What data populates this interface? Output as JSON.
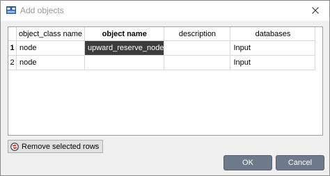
{
  "window": {
    "title": "Add objects"
  },
  "table": {
    "headers": [
      "object_class name",
      "object name",
      "description",
      "databases"
    ],
    "rows": [
      {
        "num": "1",
        "cells": [
          "node",
          "upward_reserve_node",
          "",
          "Input"
        ]
      },
      {
        "num": "2",
        "cells": [
          "node",
          "",
          "",
          "Input"
        ]
      }
    ]
  },
  "buttons": {
    "remove_rows": "Remove selected rows",
    "ok": "OK",
    "cancel": "Cancel"
  },
  "icons": {
    "title": "app-table-icon",
    "close": "close-icon",
    "remove": "remove-rows-icon"
  },
  "colors": {
    "selected_cell": "#3c3c3c",
    "dialog_button": "#6e7a8a"
  }
}
